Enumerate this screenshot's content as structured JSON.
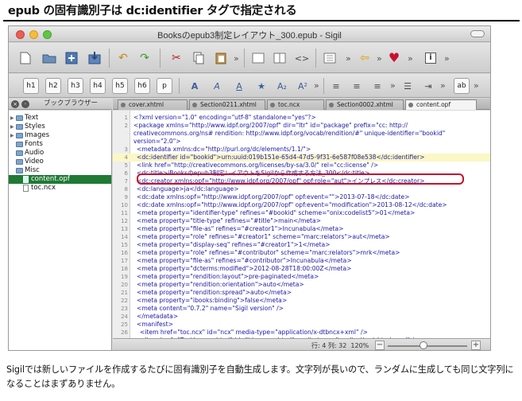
{
  "heading": "epub の固有識別子は dc:identifier タグで指定される",
  "window": {
    "title": "Booksのepub3制定レイアウト_300.epub - Sigil",
    "colors": {
      "selection": "#1f7a34",
      "highlight_box": "#c8102e",
      "tag": "#1a1aa6",
      "current_line": "#fbf7c6"
    }
  },
  "toolbar1": {
    "icons": [
      "new-file-icon",
      "open-folder-icon",
      "add-file-icon",
      "save-icon",
      "undo-icon",
      "redo-icon",
      "cut-icon",
      "copy-icon",
      "paste-icon",
      "book-view-icon",
      "split-view-icon",
      "code-view-icon",
      "toc-icon",
      "back-icon",
      "heart-icon",
      "info-icon"
    ],
    "glyphs": {
      "code": "<>",
      "info": "i"
    }
  },
  "toolbar2": {
    "headings": [
      "h1",
      "h2",
      "h3",
      "h4",
      "h5",
      "h6",
      "p"
    ],
    "ab": "ab"
  },
  "sidebar": {
    "title": "ブックブラウザー",
    "items": [
      {
        "label": "Text",
        "type": "folder"
      },
      {
        "label": "Styles",
        "type": "folder"
      },
      {
        "label": "Images",
        "type": "folder"
      },
      {
        "label": "Fonts",
        "type": "folder"
      },
      {
        "label": "Audio",
        "type": "folder"
      },
      {
        "label": "Video",
        "type": "folder"
      },
      {
        "label": "Misc",
        "type": "folder"
      },
      {
        "label": "content.opf",
        "type": "file"
      },
      {
        "label": "toc.ncx",
        "type": "file"
      }
    ]
  },
  "tabs": [
    "cover.xhtml",
    "Section0211.xhtml",
    "toc.ncx",
    "Section0002.xhtml",
    "content.opf"
  ],
  "editor": {
    "lines": [
      {
        "n": "1",
        "text": "<?xml version=\"1.0\" encoding=\"utf-8\" standalone=\"yes\"?>"
      },
      {
        "n": "2",
        "text": "<package xmlns=\"http://www.idpf.org/2007/opf\" dir=\"ltr\" id=\"package\" prefix=\"cc: http://"
      },
      {
        "n": "",
        "text": "creativecommons.org/ns# rendition: http://www.idpf.org/vocab/rendition/#\" unique-identifier=\"bookid\""
      },
      {
        "n": "",
        "text": "version=\"2.0\">"
      },
      {
        "n": "3",
        "text": "<metadata xmlns:dc=\"http://purl.org/dc/elements/1.1/\">"
      },
      {
        "n": "4",
        "text": "<dc:identifier id=\"bookid\">urn:uuid:019b151e-65d4-47d5-9f31-6e587f08e538</dc:identifier>"
      },
      {
        "n": "5",
        "text": "<link href=\"http://creativecommons.org/licenses/by-sa/3.0/\" rel=\"cc:license\" />"
      },
      {
        "n": "6",
        "text": "<dc:title>iBooksのepub3制定レイアウトをSigilから作成する方法_300</dc:title>"
      },
      {
        "n": "7",
        "text": "<dc:creator xmlns:opf=\"http://www.idpf.org/2007/opf\" opf:role=\"aut\">インプレス</dc:creator>"
      },
      {
        "n": "8",
        "text": "<dc:language>ja</dc:language>"
      },
      {
        "n": "9",
        "text": "<dc:date xmlns:opf=\"http://www.idpf.org/2007/opf\" opf:event=\"\">2013-07-18</dc:date>"
      },
      {
        "n": "10",
        "text": "<dc:date xmlns:opf=\"http://www.idpf.org/2007/opf\" opf:event=\"modification\">2013-08-12</dc:date>"
      },
      {
        "n": "11",
        "text": "<meta property=\"identifier-type\" refines=\"#bookid\" scheme=\"onix:codelist5\">01</meta>"
      },
      {
        "n": "12",
        "text": "<meta property=\"title-type\" refines=\"#title\">main</meta>"
      },
      {
        "n": "13",
        "text": "<meta property=\"file-as\" refines=\"#creator1\">Incunabula</meta>"
      },
      {
        "n": "14",
        "text": "<meta property=\"role\" refines=\"#creator1\" scheme=\"marc:relators\">aut</meta>"
      },
      {
        "n": "15",
        "text": "<meta property=\"display-seq\" refines=\"#creator1\">1</meta>"
      },
      {
        "n": "16",
        "text": "<meta property=\"role\" refines=\"#contributor\" scheme=\"marc:relators\">mrk</meta>"
      },
      {
        "n": "17",
        "text": "<meta property=\"file-as\" refines=\"#contributor\">Incunabula</meta>"
      },
      {
        "n": "18",
        "text": "<meta property=\"dcterms:modified\">2012-08-28T18:00:00Z</meta>"
      },
      {
        "n": "19",
        "text": "<meta property=\"rendition:layout\">pre-paginated</meta>"
      },
      {
        "n": "20",
        "text": "<meta property=\"rendition:orientation\">auto</meta>"
      },
      {
        "n": "21",
        "text": "<meta property=\"rendition:spread\">auto</meta>"
      },
      {
        "n": "22",
        "text": "<meta property=\"ibooks:binding\">false</meta>"
      },
      {
        "n": "23",
        "text": "<meta content=\"0.7.2\" name=\"Sigil version\" />"
      },
      {
        "n": "24",
        "text": "</metadata>"
      },
      {
        "n": "25",
        "text": "<manifest>"
      },
      {
        "n": "26",
        "text": "<item href=\"toc.ncx\" id=\"ncx\" media-type=\"application/x-dtbncx+xml\" />"
      },
      {
        "n": "27",
        "text": "<item href=\"Text/cover.xhtml\" id=\"id-cover-xhtml\" media-type=\"application/xhtml+xml\" />"
      }
    ]
  },
  "status": {
    "position": "行: 4 列: 32",
    "zoom": "120%",
    "minus": "−",
    "plus": "+",
    "zoom_level": 0.45
  },
  "caption": "Sigilでは新しいファイルを作成するたびに固有識別子を自動生成します。文字列が長いので、ランダムに生成しても同じ文字列になることはまずありません。"
}
